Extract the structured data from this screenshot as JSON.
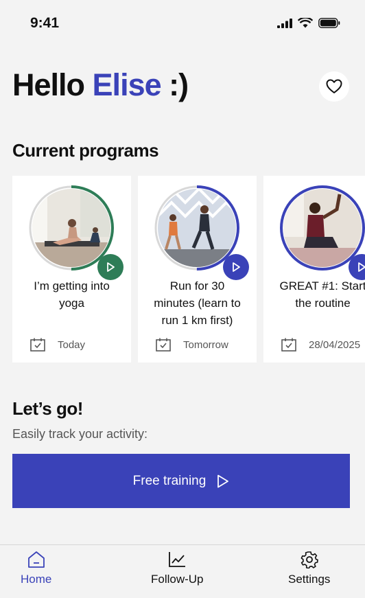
{
  "status": {
    "time": "9:41"
  },
  "header": {
    "greeting_prefix": "Hello",
    "user_name": "Elise",
    "greeting_suffix": ":)"
  },
  "programs": {
    "title": "Current programs",
    "items": [
      {
        "title": "I’m getting into\nyoga",
        "date": "Today",
        "accent": "#2e7d57",
        "progress": 0.5
      },
      {
        "title": "Run for 30\nminutes (learn to\nrun 1 km first)",
        "date": "Tomorrow",
        "accent": "#3a42b8",
        "progress": 0.5
      },
      {
        "title": "GREAT #1: Start\nthe routine",
        "date": "28/04/2025",
        "accent": "#3a42b8",
        "progress": 1.0
      }
    ]
  },
  "activity": {
    "title": "Let’s go!",
    "subtitle": "Easily track your activity:",
    "button_label": "Free training"
  },
  "tabbar": {
    "home": "Home",
    "follow_up": "Follow-Up",
    "settings": "Settings"
  },
  "colors": {
    "accent": "#3a42b8",
    "green": "#2e7d57",
    "background": "#f3f3f3"
  }
}
